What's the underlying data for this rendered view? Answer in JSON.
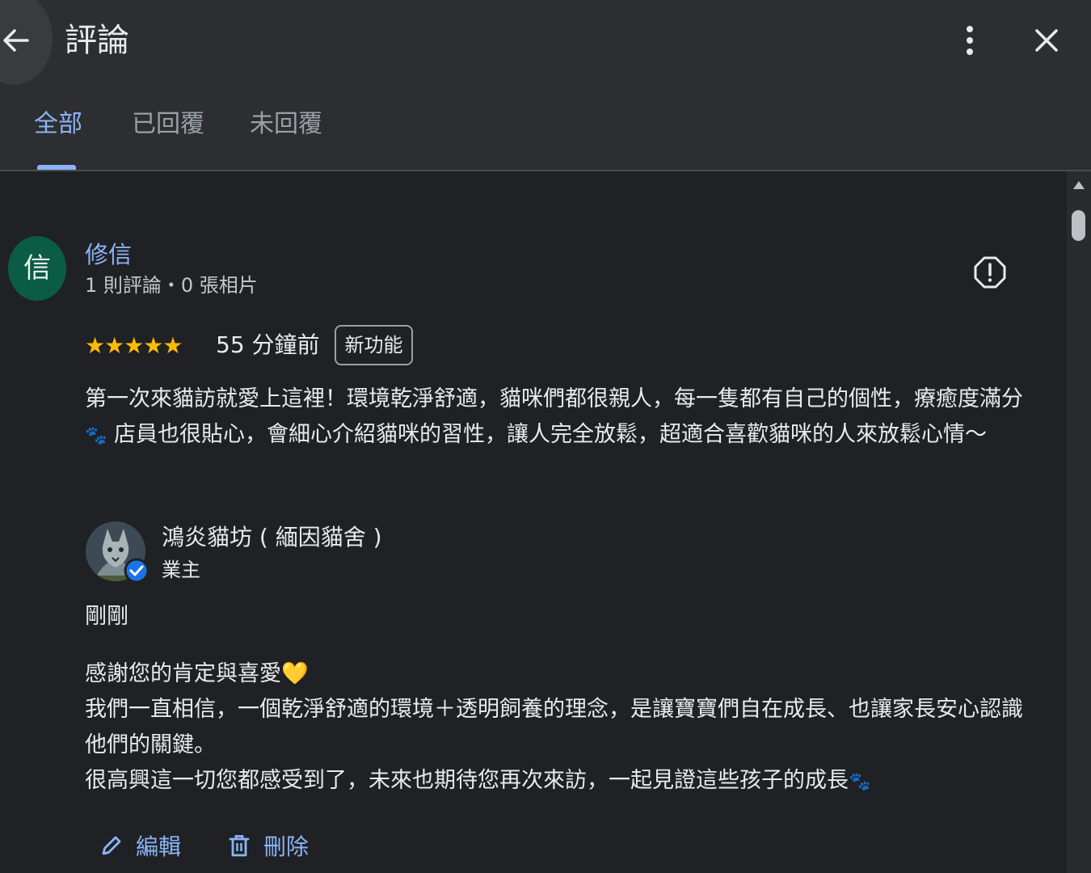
{
  "header": {
    "title": "評論",
    "tabs": [
      {
        "label": "全部",
        "active": true
      },
      {
        "label": "已回覆",
        "active": false
      },
      {
        "label": "未回覆",
        "active": false
      }
    ],
    "icons": [
      "back-arrow-icon",
      "more-vertical-icon",
      "close-icon"
    ]
  },
  "review": {
    "avatar_letter": "信",
    "avatar_color": "#0b5c44",
    "reviewer_name": "修信",
    "reviewer_meta": "1 則評論・0 張相片",
    "rating": 5,
    "stars": "★★★★★",
    "time_ago": "55 分鐘前",
    "badge": "新功能",
    "text_part1": "第一次來貓訪就愛上這裡！環境乾淨舒適，貓咪們都很親人，每一隻都有自己的個性，療癒度滿分",
    "paw": "🐾",
    "text_part2": " 店員也很貼心，會細心介紹貓咪的習性，讓人完全放鬆，超適合喜歡貓咪的人來放鬆心情～"
  },
  "reply": {
    "owner_name": "鴻炎貓坊 ( 緬因貓舍 )",
    "owner_role": "業主",
    "time": "剛剛",
    "line1": "感謝您的肯定與喜愛",
    "heart": "💛",
    "line2": "我們一直相信，一個乾淨舒適的環境＋透明飼養的理念，是讓寶寶們自在成長、也讓家長安心認識他們的關鍵。",
    "line3": "很高興這一切您都感受到了，未來也期待您再次來訪，一起見證這些孩子的成長",
    "paw": "🐾"
  },
  "actions": {
    "edit_label": "編輯",
    "delete_label": "刪除"
  },
  "colors": {
    "accent": "#8ab4f8",
    "star": "#fbbc04",
    "background": "#202124",
    "header": "#2d2e31"
  }
}
